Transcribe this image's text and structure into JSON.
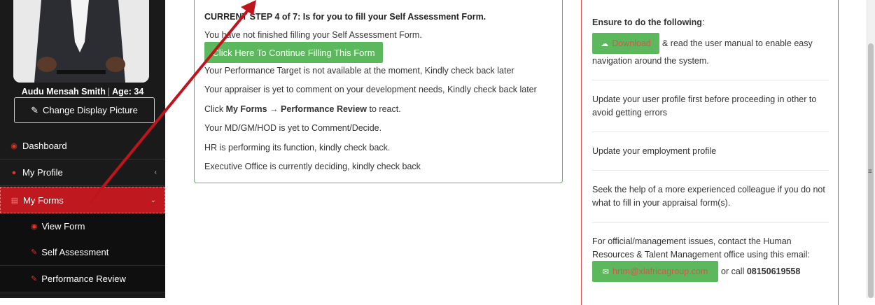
{
  "user": {
    "name": "Audu Mensah Smith",
    "age_label": "Age: 34",
    "change_picture_label": "Change Display Picture"
  },
  "nav": {
    "dashboard": "Dashboard",
    "my_profile": "My Profile",
    "my_forms": "My Forms",
    "view_form": "View Form",
    "self_assessment": "Self Assessment",
    "performance_review": "Performance Review"
  },
  "step": {
    "title": "CURRENT STEP 4 of 7: Is for you to fill your Self Assessment Form.",
    "not_finished": "You have not finished filling your Self Assessment Form.",
    "continue_button": "Click Here To Continue Filling This Form",
    "target_status": "Your Performance Target is not available at the moment, Kindly check back later",
    "appraiser_status": "Your appraiser is yet to comment on your development needs, Kindly check back later",
    "click_prefix": "Click ",
    "click_path": "My Forms → Performance Review",
    "click_suffix": " to react.",
    "md_status": "Your MD/GM/HOD is yet to Comment/Decide.",
    "hr_status": "HR is performing its function, kindly check back.",
    "exec_status": "Executive Office is currently deciding, kindly check back"
  },
  "tips": {
    "heading": "Ensure to do the following",
    "download_button": "Download",
    "download_text": "& read the user manual to enable easy",
    "download_text2": "navigation around the system.",
    "profile_tip": "Update your user profile first before proceeding in other to avoid getting errors",
    "employment_tip": "Update your employment profile",
    "help_tip": "Seek the help of a more experienced colleague if you do not what to fill in your appraisal form(s).",
    "contact_tip": "For official/management issues, contact the Human Resources & Talent Management office using this email:",
    "email": "hrtm@xlafricagroup.com",
    "or_call": "or call",
    "phone": "08150619558"
  },
  "icons": {
    "pencil": "pencil-icon",
    "dashboard": "dashboard-icon",
    "user": "user-icon",
    "forms": "forms-icon",
    "eye": "eye-icon",
    "edit": "edit-icon",
    "cloud_download": "cloud-download-icon",
    "envelope": "envelope-icon",
    "chevron_left": "chevron-left-icon",
    "chevron_down": "chevron-down-icon"
  },
  "colors": {
    "sidebar_bg": "#1a1a1a",
    "active_nav": "#c0181f",
    "success": "#5cb85c",
    "danger": "#d9534f",
    "annotation_arrow": "#c0141c"
  }
}
